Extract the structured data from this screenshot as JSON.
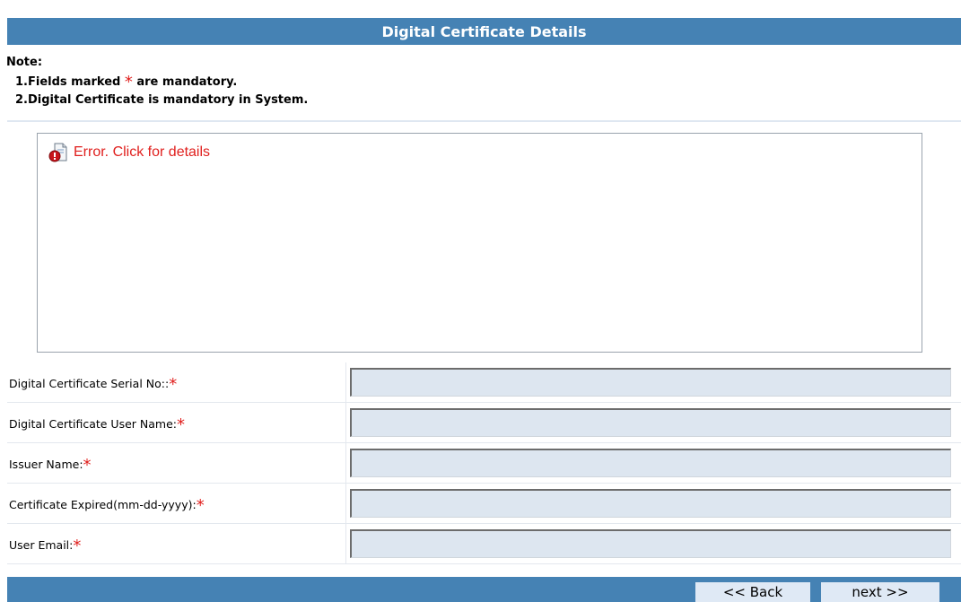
{
  "header": {
    "title": "Digital Certificate Details"
  },
  "note": {
    "label": "Note:",
    "line1_prefix": "1.Fields marked",
    "line1_star": "*",
    "line1_suffix": "are mandatory.",
    "line2": "2.Digital Certificate is mandatory in System."
  },
  "applet": {
    "error_text": "Error. Click for details",
    "icon": "java-error-icon"
  },
  "form": {
    "required_marker": "*",
    "fields": [
      {
        "label": "Digital Certificate Serial No::",
        "value": ""
      },
      {
        "label": "Digital Certificate User Name:",
        "value": ""
      },
      {
        "label": "Issuer Name:",
        "value": ""
      },
      {
        "label": "Certificate Expired(mm-dd-yyyy):",
        "value": ""
      },
      {
        "label": "User Email:",
        "value": ""
      }
    ]
  },
  "footer": {
    "back_label": "<< Back",
    "next_label": "next >>"
  },
  "colors": {
    "header_bg": "#4582b4",
    "required": "#e0201e",
    "input_bg": "#dde6f0",
    "button_bg": "#dfe9f5"
  }
}
